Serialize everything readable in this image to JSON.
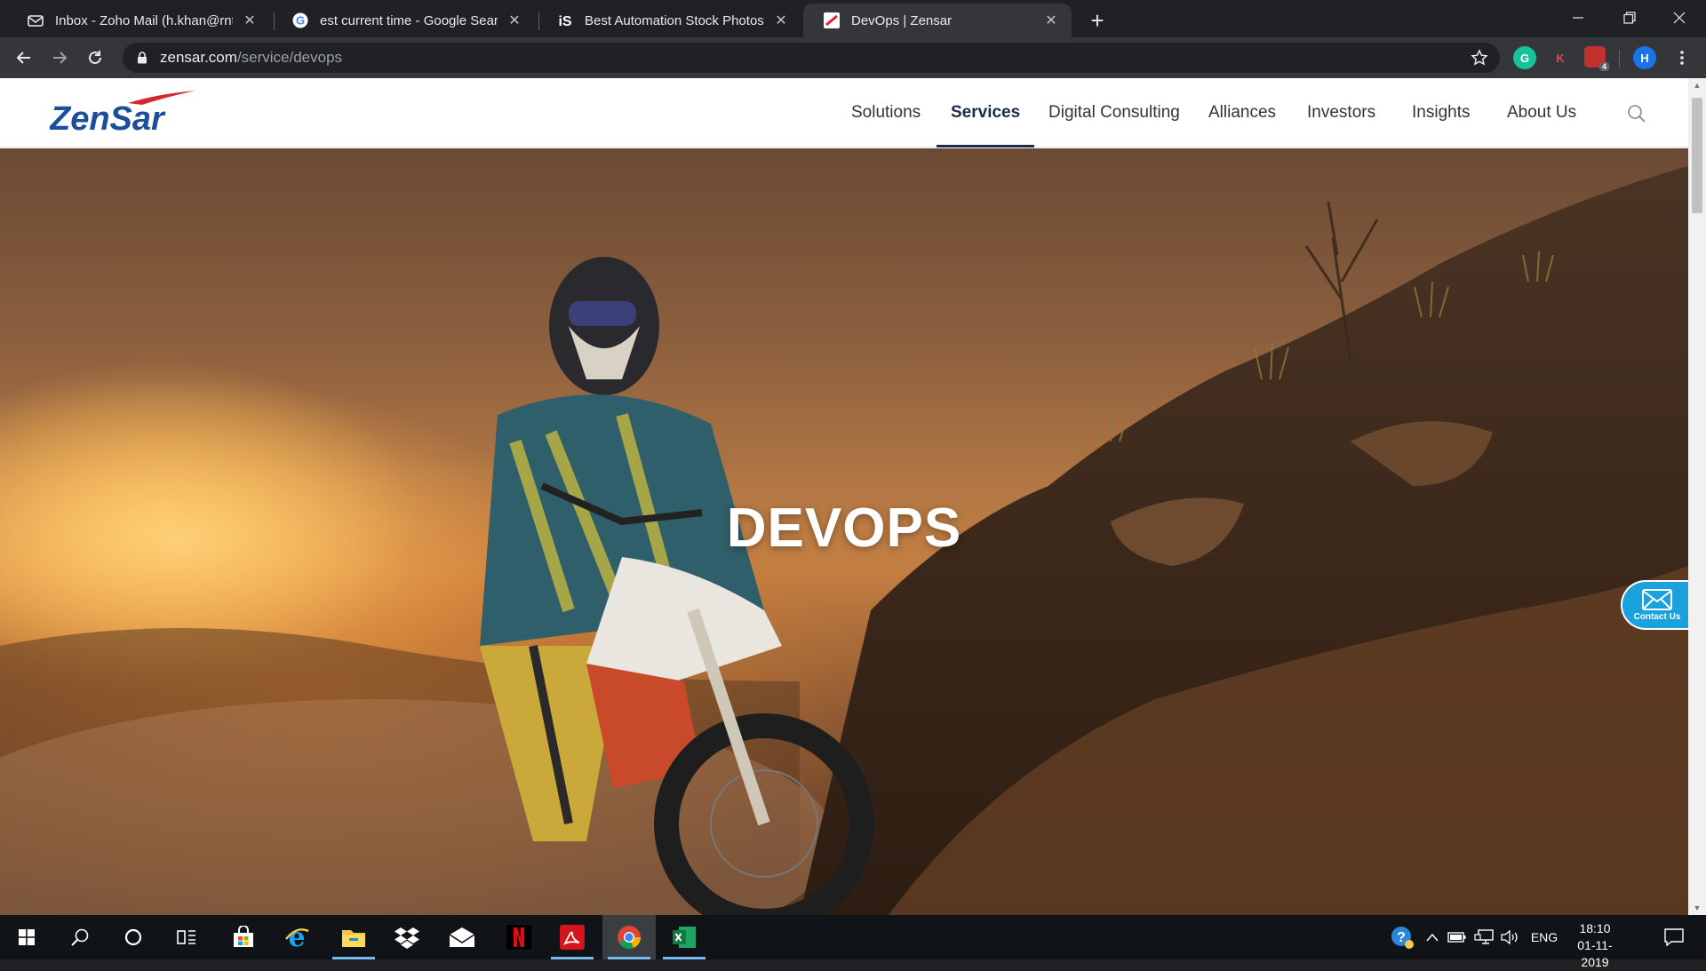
{
  "browser": {
    "tabs": [
      {
        "title": "Inbox - Zoho Mail (h.khan@rnt.ai)",
        "icon": "zoho-mail-icon",
        "active": false
      },
      {
        "title": "est current time - Google Search",
        "icon": "google-icon",
        "active": false
      },
      {
        "title": "Best Automation Stock Photos, Pictures",
        "icon": "istock-icon",
        "active": false
      },
      {
        "title": "DevOps | Zensar",
        "icon": "zensar-icon",
        "active": true
      }
    ],
    "new_tab": "+",
    "url_host": "zensar.com",
    "url_path": "/service/devops",
    "extensions": {
      "grammarly": "G",
      "kaspersky": "K",
      "adblock_badge": "4",
      "profile": "H"
    }
  },
  "site": {
    "logo_text": "ZenSar",
    "nav": [
      "Solutions",
      "Services",
      "Digital Consulting",
      "Alliances",
      "Investors",
      "Insights",
      "About Us"
    ],
    "active_nav": "Services",
    "hero_title": "DEVOPS",
    "contact_label": "Contact Us"
  },
  "taskbar": {
    "language": "ENG",
    "time": "18:10",
    "date": "01-11-2019"
  },
  "colors": {
    "brand_navy": "#1a2c47",
    "brand_blue": "#1b4f9c",
    "brand_red": "#d7262e",
    "contact_blue": "#1ba1db"
  }
}
